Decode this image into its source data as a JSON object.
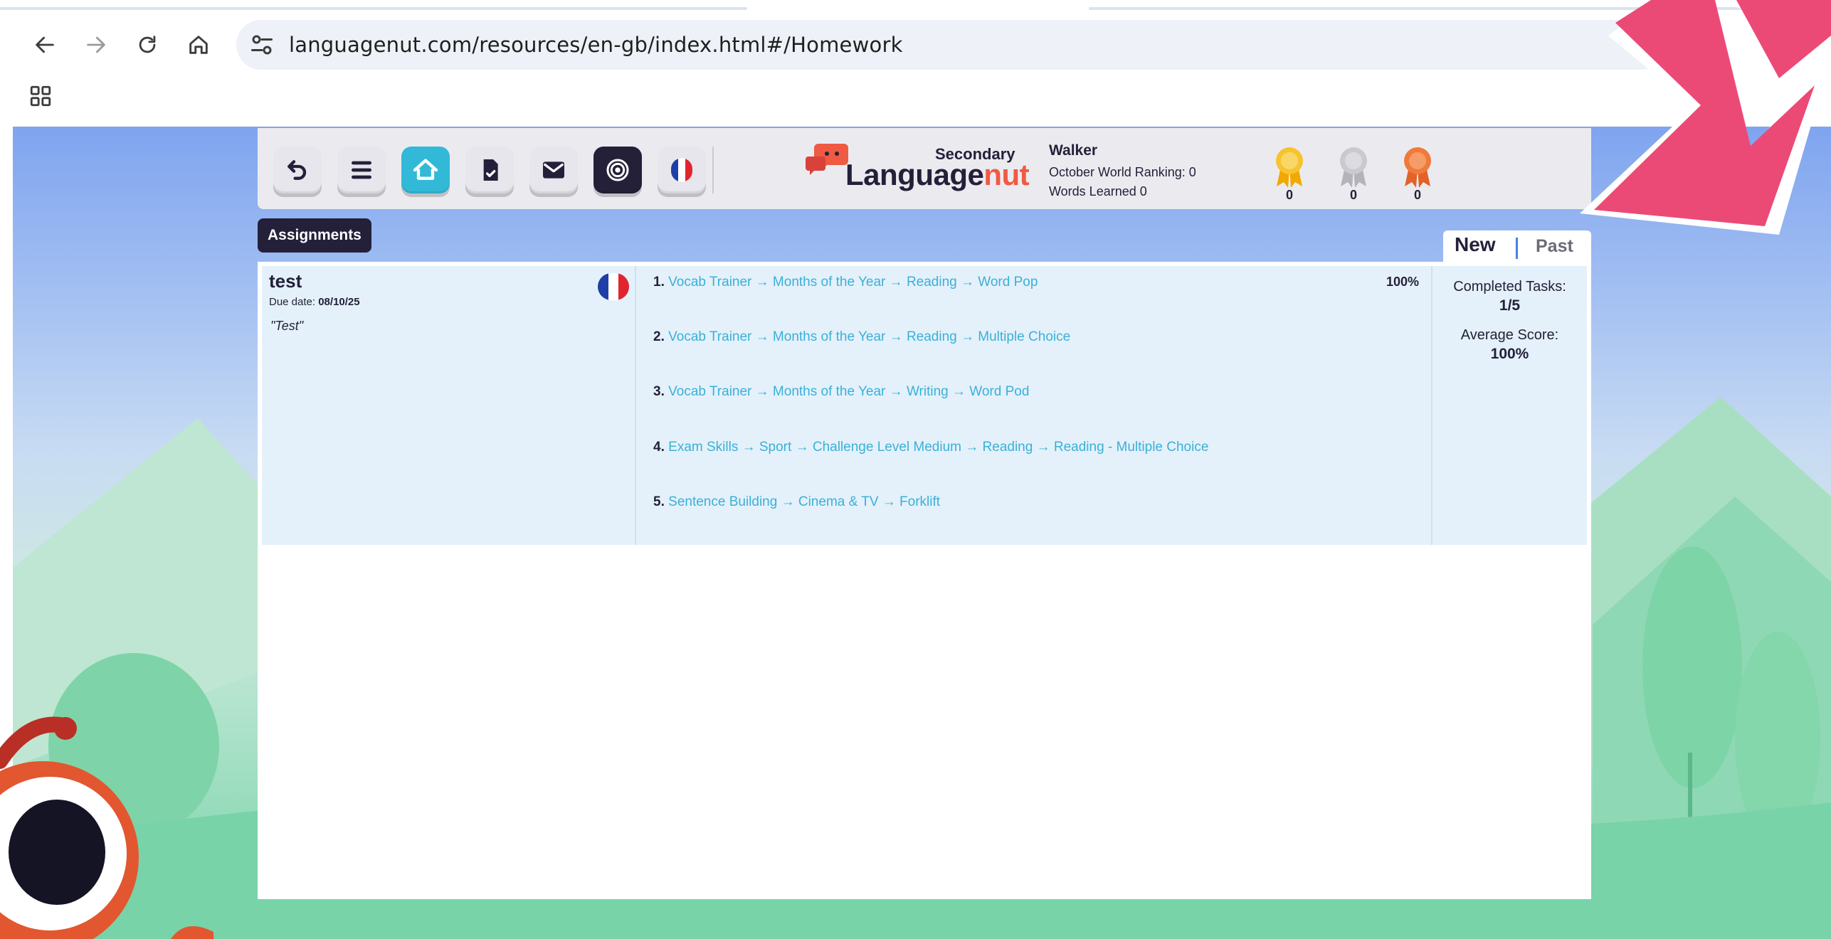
{
  "browser": {
    "url": "languagenut.com/resources/en-gb/index.html#/Homework",
    "nav": {
      "back_icon": "arrow-left-icon",
      "forward_icon": "arrow-right-icon",
      "reload_icon": "reload-icon",
      "home_icon": "home-icon"
    }
  },
  "app": {
    "toolbar": [
      "back-curl-icon",
      "menu-icon",
      "home-icon",
      "homework-icon",
      "mail-icon",
      "live-icon",
      "french-flag-icon"
    ],
    "logo": {
      "secondary": "Secondary",
      "main_part1": "Language",
      "main_part2": "nut"
    },
    "user": {
      "name": "Walker",
      "ranking": "October World Ranking: 0",
      "words": "Words Learned 0"
    },
    "medals": [
      {
        "icon": "gold-medal-icon",
        "color": "#f7c430",
        "count": "0"
      },
      {
        "icon": "silver-medal-icon",
        "color": "#c9c9cf",
        "count": "0"
      },
      {
        "icon": "bronze-medal-icon",
        "color": "#f07a3a",
        "count": "0"
      }
    ]
  },
  "assignments": {
    "label": "Assignments",
    "tabs": {
      "new": "New",
      "past": "Past"
    },
    "homework": {
      "title": "test",
      "due_label": "Due date: ",
      "due_date": "08/10/25",
      "note": "\"Test\"",
      "tasks": [
        {
          "num": "1.",
          "text": "Vocab Trainer → Months of the Year → Reading → Word Pop",
          "score": "100%"
        },
        {
          "num": "2.",
          "text": "Vocab Trainer → Months of the Year → Reading → Multiple Choice"
        },
        {
          "num": "3.",
          "text": "Vocab Trainer → Months of the Year → Writing → Word Pod"
        },
        {
          "num": "4.",
          "text": "Exam Skills → Sport → Challenge Level Medium → Reading → Reading - Multiple Choice"
        },
        {
          "num": "5.",
          "text": "Sentence Building → Cinema & TV → Forklift"
        }
      ],
      "completed_label": "Completed Tasks:",
      "completed_value": "1/5",
      "average_label": "Average Score:",
      "average_value": "100%"
    }
  },
  "colors": {
    "accent": "#32b9d8",
    "dark": "#24203a",
    "arrow": "#ec4a76",
    "link": "#3ab0d8"
  }
}
